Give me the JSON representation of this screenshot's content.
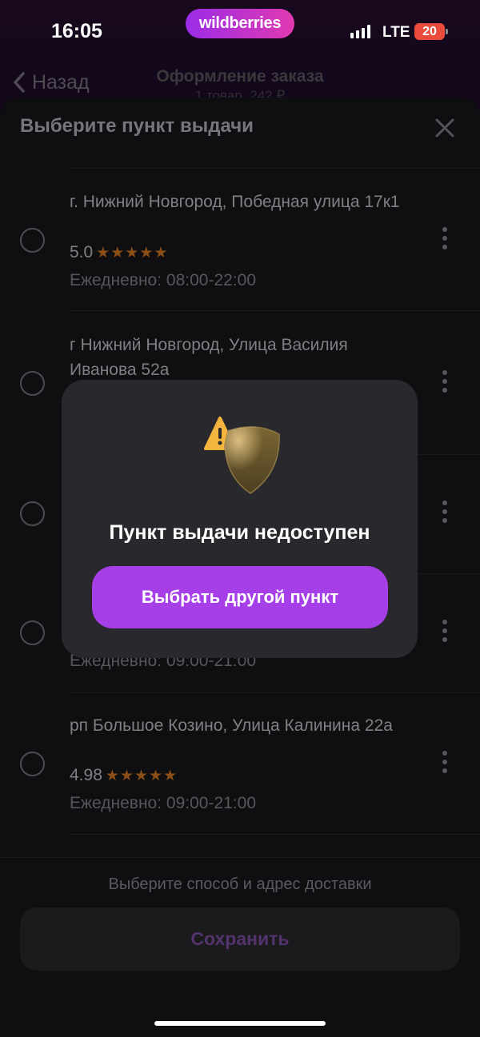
{
  "status_bar": {
    "time": "16:05",
    "brand": "wildberries",
    "network": "LTE",
    "battery": "20"
  },
  "nav": {
    "back_label": "Назад",
    "title": "Оформление заказа",
    "subtitle": "1 товар, 242 ₽"
  },
  "sheet": {
    "title": "Выберите пункт выдачи"
  },
  "pickup_points": [
    {
      "address": "г. Нижний Новгород, Победная улица 17к1",
      "rating": "5.0",
      "stars": "★★★★★",
      "hours": "Ежедневно: 08:00-22:00"
    },
    {
      "address": "г Нижний Новгород, Улица Василия Иванова 52а"
    },
    {
      "address": ""
    },
    {
      "address": "",
      "hours": "Ежедневно: 09:00-21:00"
    },
    {
      "address": "рп Большое Козино, Улица Калинина 22а",
      "rating": "4.98",
      "stars": "★★★★★",
      "hours": "Ежедневно: 09:00-21:00"
    }
  ],
  "footer": {
    "hint": "Выберите способ и адрес доставки",
    "save_label": "Сохранить"
  },
  "modal": {
    "title": "Пункт выдачи недоступен",
    "button_label": "Выбрать другой пункт"
  },
  "colors": {
    "accent": "#a63fe8",
    "brand_gradient_start": "#9b2ce8",
    "brand_gradient_end": "#e13ab0",
    "star": "#8a4e16",
    "warning": "#f4b53f"
  },
  "icons": [
    "back-chevron-icon",
    "close-icon",
    "more-vertical-icon",
    "warning-shield-icon"
  ]
}
